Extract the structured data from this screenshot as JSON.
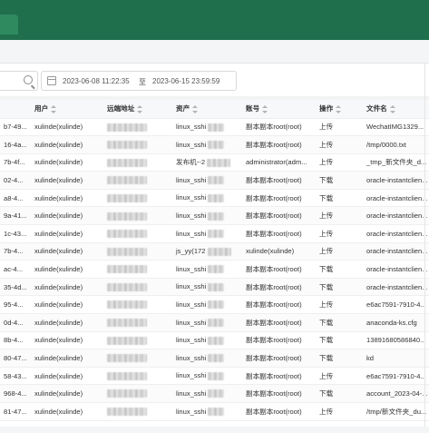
{
  "header": {
    "bg": "#1f6e4c"
  },
  "filters": {
    "date_start": "2023-06-08 11:22:35",
    "date_sep": "至",
    "date_end": "2023-06-15 23:59:59"
  },
  "table": {
    "columns": [
      "",
      "用户",
      "远端地址",
      "资产",
      "账号",
      "操作",
      "文件名"
    ],
    "rows": [
      {
        "id": "b7-49...",
        "user": "xulinde(xulinde)",
        "asset": "linux_sshi",
        "account": "副本副本root(root)",
        "op": "上传",
        "file": "WechatIMG1329..."
      },
      {
        "id": "16-4a...",
        "user": "xulinde(xulinde)",
        "asset": "linux_sshi",
        "account": "副本副本root(root)",
        "op": "上传",
        "file": "/tmp/0000.txt"
      },
      {
        "id": "7b-4f...",
        "user": "xulinde(xulinde)",
        "asset": "发布机--2",
        "account": "administrator(adm...",
        "op": "上传",
        "file": "_tmp_新文件夹_d..."
      },
      {
        "id": "02-4...",
        "user": "xulinde(xulinde)",
        "asset": "linux_sshi",
        "account": "副本副本root(root)",
        "op": "下载",
        "file": "oracle-instantclien..."
      },
      {
        "id": "a8-4...",
        "user": "xulinde(xulinde)",
        "asset": "linux_sshi",
        "account": "副本副本root(root)",
        "op": "下载",
        "file": "oracle-instantclien..."
      },
      {
        "id": "9a-41...",
        "user": "xulinde(xulinde)",
        "asset": "linux_sshi",
        "account": "副本副本root(root)",
        "op": "上传",
        "file": "oracle-instantclien..."
      },
      {
        "id": "1c-43...",
        "user": "xulinde(xulinde)",
        "asset": "linux_sshi",
        "account": "副本副本root(root)",
        "op": "上传",
        "file": "oracle-instantclien..."
      },
      {
        "id": "7b-4...",
        "user": "xulinde(xulinde)",
        "asset": "js_yy(172",
        "account": "xulinde(xulinde)",
        "op": "上传",
        "file": "oracle-instantclien..."
      },
      {
        "id": "ac-4...",
        "user": "xulinde(xulinde)",
        "asset": "linux_sshi",
        "account": "副本副本root(root)",
        "op": "下载",
        "file": "oracle-instantclien..."
      },
      {
        "id": "35-4d...",
        "user": "xulinde(xulinde)",
        "asset": "linux_sshi",
        "account": "副本副本root(root)",
        "op": "下载",
        "file": "oracle-instantclien..."
      },
      {
        "id": "95-4...",
        "user": "xulinde(xulinde)",
        "asset": "linux_sshi",
        "account": "副本副本root(root)",
        "op": "上传",
        "file": "e6ac7591-7910-4..."
      },
      {
        "id": "0d-4...",
        "user": "xulinde(xulinde)",
        "asset": "linux_sshi",
        "account": "副本副本root(root)",
        "op": "下载",
        "file": "anaconda-ks.cfg"
      },
      {
        "id": "8b-4...",
        "user": "xulinde(xulinde)",
        "asset": "linux_sshi",
        "account": "副本副本root(root)",
        "op": "下载",
        "file": "13891680586840..."
      },
      {
        "id": "80-47...",
        "user": "xulinde(xulinde)",
        "asset": "linux_sshi",
        "account": "副本副本root(root)",
        "op": "下载",
        "file": "kd"
      },
      {
        "id": "58-43...",
        "user": "xulinde(xulinde)",
        "asset": "linux_sshi",
        "account": "副本副本root(root)",
        "op": "上传",
        "file": "e6ac7591-7910-4..."
      },
      {
        "id": "968-4...",
        "user": "xulinde(xulinde)",
        "asset": "linux_sshi",
        "account": "副本副本root(root)",
        "op": "下载",
        "file": "account_2023-04-..."
      },
      {
        "id": "81-47...",
        "user": "xulinde(xulinde)",
        "asset": "linux_sshi",
        "account": "副本副本root(root)",
        "op": "上传",
        "file": "/tmp/新文件夹_du..."
      }
    ]
  }
}
